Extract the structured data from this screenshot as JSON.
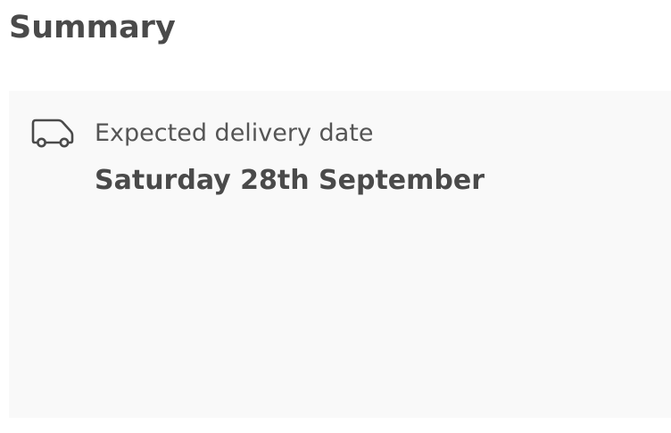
{
  "page": {
    "title": "Summary"
  },
  "delivery": {
    "icon": "delivery-van-icon",
    "label": "Expected delivery date",
    "date": "Saturday 28th September"
  },
  "colors": {
    "text": "#4a4a4a",
    "card_background": "#f9f9f9",
    "background": "#ffffff"
  }
}
